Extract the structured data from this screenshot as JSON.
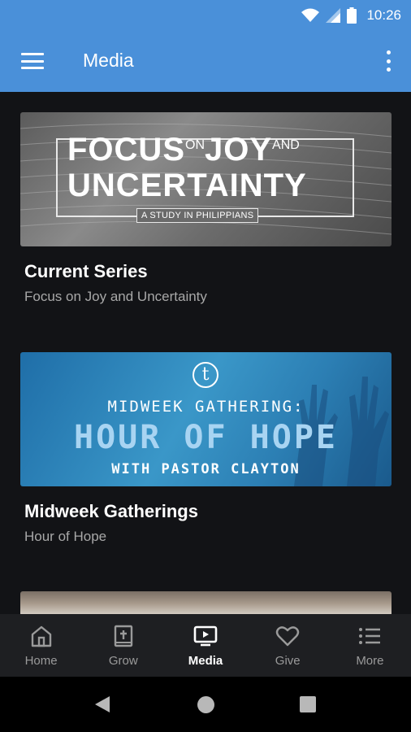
{
  "status_bar": {
    "time": "10:26",
    "icons": [
      "wifi-icon",
      "signal-icon",
      "battery-icon"
    ]
  },
  "app_bar": {
    "title": "Media",
    "menu_icon": "hamburger-menu-icon",
    "overflow_icon": "more-vert-icon"
  },
  "cards": [
    {
      "title": "Current Series",
      "subtitle": "Focus on Joy and Uncertainty",
      "banner": {
        "line1_a": "FOCUS",
        "line1_b": "ON",
        "line1_c": "JOY",
        "line1_d": "AND",
        "line2": "UNCERTAINTY",
        "tag": "A STUDY IN PHILIPPIANS"
      }
    },
    {
      "title": "Midweek Gatherings",
      "subtitle": "Hour of Hope",
      "banner": {
        "line1": "MIDWEEK GATHERING:",
        "line2": "HOUR OF HOPE",
        "line3": "WITH PASTOR CLAYTON"
      }
    }
  ],
  "bottom_nav": [
    {
      "label": "Home",
      "icon": "home-icon",
      "active": false
    },
    {
      "label": "Grow",
      "icon": "bible-icon",
      "active": false
    },
    {
      "label": "Media",
      "icon": "tv-play-icon",
      "active": true
    },
    {
      "label": "Give",
      "icon": "heart-icon",
      "active": false
    },
    {
      "label": "More",
      "icon": "list-icon",
      "active": false
    }
  ],
  "colors": {
    "app_bar": "#4a90d9",
    "background": "#121316",
    "nav_background": "#1e1f22",
    "subtitle": "#a8a8a8"
  }
}
